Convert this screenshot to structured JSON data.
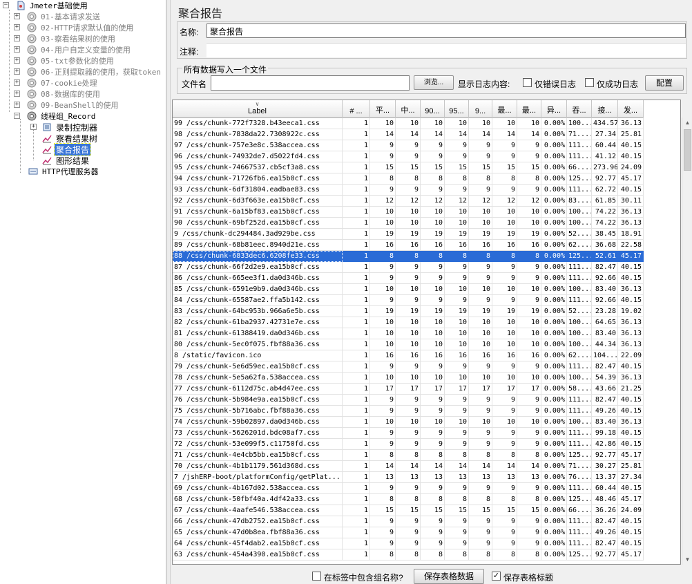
{
  "tree": {
    "root": "Jmeter基础使用",
    "items": [
      {
        "label": "01-基本请求发送",
        "disabled": true
      },
      {
        "label": "02-HTTP请求默认值的使用",
        "disabled": true
      },
      {
        "label": "03-察看结果树的使用",
        "disabled": true
      },
      {
        "label": "04-用户自定义变量的使用",
        "disabled": true
      },
      {
        "label": "05-txt参数化的使用",
        "disabled": true
      },
      {
        "label": "06-正则提取器的使用，获取token",
        "disabled": true
      },
      {
        "label": "07-cookie处理",
        "disabled": true
      },
      {
        "label": "08-数据库的使用",
        "disabled": true
      },
      {
        "label": "09-BeanShell的使用",
        "disabled": true
      }
    ],
    "thread_group": "线程组_Record",
    "children": [
      "录制控制器",
      "察看结果树",
      "聚合报告",
      "图形结果"
    ],
    "proxy": "HTTP代理服务器"
  },
  "panel": {
    "title": "聚合报告",
    "name_label": "名称:",
    "name_value": "聚合报告",
    "comment_label": "注释:",
    "comment_value": "",
    "file_group_title": "所有数据写入一个文件",
    "filename_label": "文件名",
    "filename_value": "",
    "browse_button": "浏览...",
    "log_label": "显示日志内容:",
    "errors_only": "仅错误日志",
    "success_only": "仅成功日志",
    "config_button": "配置"
  },
  "table": {
    "columns": [
      "Label",
      "# ...",
      "平...",
      "中...",
      "90...",
      "95...",
      "9...",
      "最...",
      "最...",
      "异...",
      "吞...",
      "接...",
      "发..."
    ],
    "selected_index": 12,
    "rows": [
      [
        "99 /css/chunk-772f7328.b43eeca1.css",
        "1",
        "10",
        "10",
        "10",
        "10",
        "10",
        "10",
        "10",
        "0.00%",
        "100...",
        "434.57",
        "36.13"
      ],
      [
        "98 /css/chunk-7838da22.7308922c.css",
        "1",
        "14",
        "14",
        "14",
        "14",
        "14",
        "14",
        "14",
        "0.00%",
        "71....",
        "27.34",
        "25.81"
      ],
      [
        "97 /css/chunk-757e3e8c.538accea.css",
        "1",
        "9",
        "9",
        "9",
        "9",
        "9",
        "9",
        "9",
        "0.00%",
        "111...",
        "60.44",
        "40.15"
      ],
      [
        "96 /css/chunk-74932de7.d5022fd4.css",
        "1",
        "9",
        "9",
        "9",
        "9",
        "9",
        "9",
        "9",
        "0.00%",
        "111...",
        "41.12",
        "40.15"
      ],
      [
        "95 /css/chunk-74667537.cb5cf3a8.css",
        "1",
        "15",
        "15",
        "15",
        "15",
        "15",
        "15",
        "15",
        "0.00%",
        "66....",
        "273.96",
        "24.09"
      ],
      [
        "94 /css/chunk-71726fb6.ea15b0cf.css",
        "1",
        "8",
        "8",
        "8",
        "8",
        "8",
        "8",
        "8",
        "0.00%",
        "125...",
        "92.77",
        "45.17"
      ],
      [
        "93 /css/chunk-6df31804.eadbae83.css",
        "1",
        "9",
        "9",
        "9",
        "9",
        "9",
        "9",
        "9",
        "0.00%",
        "111...",
        "62.72",
        "40.15"
      ],
      [
        "92 /css/chunk-6d3f663e.ea15b0cf.css",
        "1",
        "12",
        "12",
        "12",
        "12",
        "12",
        "12",
        "12",
        "0.00%",
        "83....",
        "61.85",
        "30.11"
      ],
      [
        "91 /css/chunk-6a15bf83.ea15b0cf.css",
        "1",
        "10",
        "10",
        "10",
        "10",
        "10",
        "10",
        "10",
        "0.00%",
        "100...",
        "74.22",
        "36.13"
      ],
      [
        "90 /css/chunk-69bf252d.ea15b0cf.css",
        "1",
        "10",
        "10",
        "10",
        "10",
        "10",
        "10",
        "10",
        "0.00%",
        "100...",
        "74.22",
        "36.13"
      ],
      [
        "9 /css/chunk-dc294484.3ad929be.css",
        "1",
        "19",
        "19",
        "19",
        "19",
        "19",
        "19",
        "19",
        "0.00%",
        "52....",
        "38.45",
        "18.91"
      ],
      [
        "89 /css/chunk-68b81eec.8940d21e.css",
        "1",
        "16",
        "16",
        "16",
        "16",
        "16",
        "16",
        "16",
        "0.00%",
        "62....",
        "36.68",
        "22.58"
      ],
      [
        "88 /css/chunk-6833dec6.6208fe33.css",
        "1",
        "8",
        "8",
        "8",
        "8",
        "8",
        "8",
        "8",
        "0.00%",
        "125...",
        "52.61",
        "45.17"
      ],
      [
        "87 /css/chunk-66f2d2e9.ea15b0cf.css",
        "1",
        "9",
        "9",
        "9",
        "9",
        "9",
        "9",
        "9",
        "0.00%",
        "111...",
        "82.47",
        "40.15"
      ],
      [
        "86 /css/chunk-665ee3f1.da0d346b.css",
        "1",
        "9",
        "9",
        "9",
        "9",
        "9",
        "9",
        "9",
        "0.00%",
        "111...",
        "92.66",
        "40.15"
      ],
      [
        "85 /css/chunk-6591e9b9.da0d346b.css",
        "1",
        "10",
        "10",
        "10",
        "10",
        "10",
        "10",
        "10",
        "0.00%",
        "100...",
        "83.40",
        "36.13"
      ],
      [
        "84 /css/chunk-65587ae2.ffa5b142.css",
        "1",
        "9",
        "9",
        "9",
        "9",
        "9",
        "9",
        "9",
        "0.00%",
        "111...",
        "92.66",
        "40.15"
      ],
      [
        "83 /css/chunk-64bc953b.966a6e5b.css",
        "1",
        "19",
        "19",
        "19",
        "19",
        "19",
        "19",
        "19",
        "0.00%",
        "52....",
        "23.28",
        "19.02"
      ],
      [
        "82 /css/chunk-61ba2937.42731e7e.css",
        "1",
        "10",
        "10",
        "10",
        "10",
        "10",
        "10",
        "10",
        "0.00%",
        "100...",
        "64.65",
        "36.13"
      ],
      [
        "81 /css/chunk-61388419.da0d346b.css",
        "1",
        "10",
        "10",
        "10",
        "10",
        "10",
        "10",
        "10",
        "0.00%",
        "100...",
        "83.40",
        "36.13"
      ],
      [
        "80 /css/chunk-5ec0f075.fbf88a36.css",
        "1",
        "10",
        "10",
        "10",
        "10",
        "10",
        "10",
        "10",
        "0.00%",
        "100...",
        "44.34",
        "36.13"
      ],
      [
        "8 /static/favicon.ico",
        "1",
        "16",
        "16",
        "16",
        "16",
        "16",
        "16",
        "16",
        "0.00%",
        "62....",
        "104...",
        "22.09"
      ],
      [
        "79 /css/chunk-5e6d59ec.ea15b0cf.css",
        "1",
        "9",
        "9",
        "9",
        "9",
        "9",
        "9",
        "9",
        "0.00%",
        "111...",
        "82.47",
        "40.15"
      ],
      [
        "78 /css/chunk-5e5a62fa.538accea.css",
        "1",
        "10",
        "10",
        "10",
        "10",
        "10",
        "10",
        "10",
        "0.00%",
        "100...",
        "54.39",
        "36.13"
      ],
      [
        "77 /css/chunk-6112d75c.ab4d47ee.css",
        "1",
        "17",
        "17",
        "17",
        "17",
        "17",
        "17",
        "17",
        "0.00%",
        "58....",
        "43.66",
        "21.25"
      ],
      [
        "76 /css/chunk-5b984e9a.ea15b0cf.css",
        "1",
        "9",
        "9",
        "9",
        "9",
        "9",
        "9",
        "9",
        "0.00%",
        "111...",
        "82.47",
        "40.15"
      ],
      [
        "75 /css/chunk-5b716abc.fbf88a36.css",
        "1",
        "9",
        "9",
        "9",
        "9",
        "9",
        "9",
        "9",
        "0.00%",
        "111...",
        "49.26",
        "40.15"
      ],
      [
        "74 /css/chunk-59b02897.da0d346b.css",
        "1",
        "10",
        "10",
        "10",
        "10",
        "10",
        "10",
        "10",
        "0.00%",
        "100...",
        "83.40",
        "36.13"
      ],
      [
        "73 /css/chunk-5626201d.bdc08af7.css",
        "1",
        "9",
        "9",
        "9",
        "9",
        "9",
        "9",
        "9",
        "0.00%",
        "111...",
        "99.18",
        "40.15"
      ],
      [
        "72 /css/chunk-53e099f5.c11750fd.css",
        "1",
        "9",
        "9",
        "9",
        "9",
        "9",
        "9",
        "9",
        "0.00%",
        "111...",
        "42.86",
        "40.15"
      ],
      [
        "71 /css/chunk-4e4cb5bb.ea15b0cf.css",
        "1",
        "8",
        "8",
        "8",
        "8",
        "8",
        "8",
        "8",
        "0.00%",
        "125...",
        "92.77",
        "45.17"
      ],
      [
        "70 /css/chunk-4b1b1179.561d368d.css",
        "1",
        "14",
        "14",
        "14",
        "14",
        "14",
        "14",
        "14",
        "0.00%",
        "71....",
        "30.27",
        "25.81"
      ],
      [
        "7 /jshERP-boot/platformConfig/getPlat...",
        "1",
        "13",
        "13",
        "13",
        "13",
        "13",
        "13",
        "13",
        "0.00%",
        "76....",
        "13.37",
        "27.34"
      ],
      [
        "69 /css/chunk-4b167d02.538accea.css",
        "1",
        "9",
        "9",
        "9",
        "9",
        "9",
        "9",
        "9",
        "0.00%",
        "111...",
        "60.44",
        "40.15"
      ],
      [
        "68 /css/chunk-50fbf40a.4df42a33.css",
        "1",
        "8",
        "8",
        "8",
        "8",
        "8",
        "8",
        "8",
        "0.00%",
        "125...",
        "48.46",
        "45.17"
      ],
      [
        "67 /css/chunk-4aafe546.538accea.css",
        "1",
        "15",
        "15",
        "15",
        "15",
        "15",
        "15",
        "15",
        "0.00%",
        "66....",
        "36.26",
        "24.09"
      ],
      [
        "66 /css/chunk-47db2752.ea15b0cf.css",
        "1",
        "9",
        "9",
        "9",
        "9",
        "9",
        "9",
        "9",
        "0.00%",
        "111...",
        "82.47",
        "40.15"
      ],
      [
        "65 /css/chunk-47d0b8ea.fbf88a36.css",
        "1",
        "9",
        "9",
        "9",
        "9",
        "9",
        "9",
        "9",
        "0.00%",
        "111...",
        "49.26",
        "40.15"
      ],
      [
        "64 /css/chunk-45f4dab2.ea15b0cf.css",
        "1",
        "9",
        "9",
        "9",
        "9",
        "9",
        "9",
        "9",
        "0.00%",
        "111...",
        "82.47",
        "40.15"
      ],
      [
        "63 /css/chunk-454a4390.ea15b0cf.css",
        "1",
        "8",
        "8",
        "8",
        "8",
        "8",
        "8",
        "8",
        "0.00%",
        "125...",
        "92.77",
        "45.17"
      ]
    ]
  },
  "bottom": {
    "include_group_label": "在标签中包含组名称?",
    "include_group_checked": false,
    "save_table_button": "保存表格数据",
    "save_header_label": "保存表格标题",
    "save_header_checked": true
  },
  "colors": {
    "selection": "#2a6bd6",
    "tree_selection": "#3875d7",
    "disabled_text": "#7f7f7f"
  }
}
